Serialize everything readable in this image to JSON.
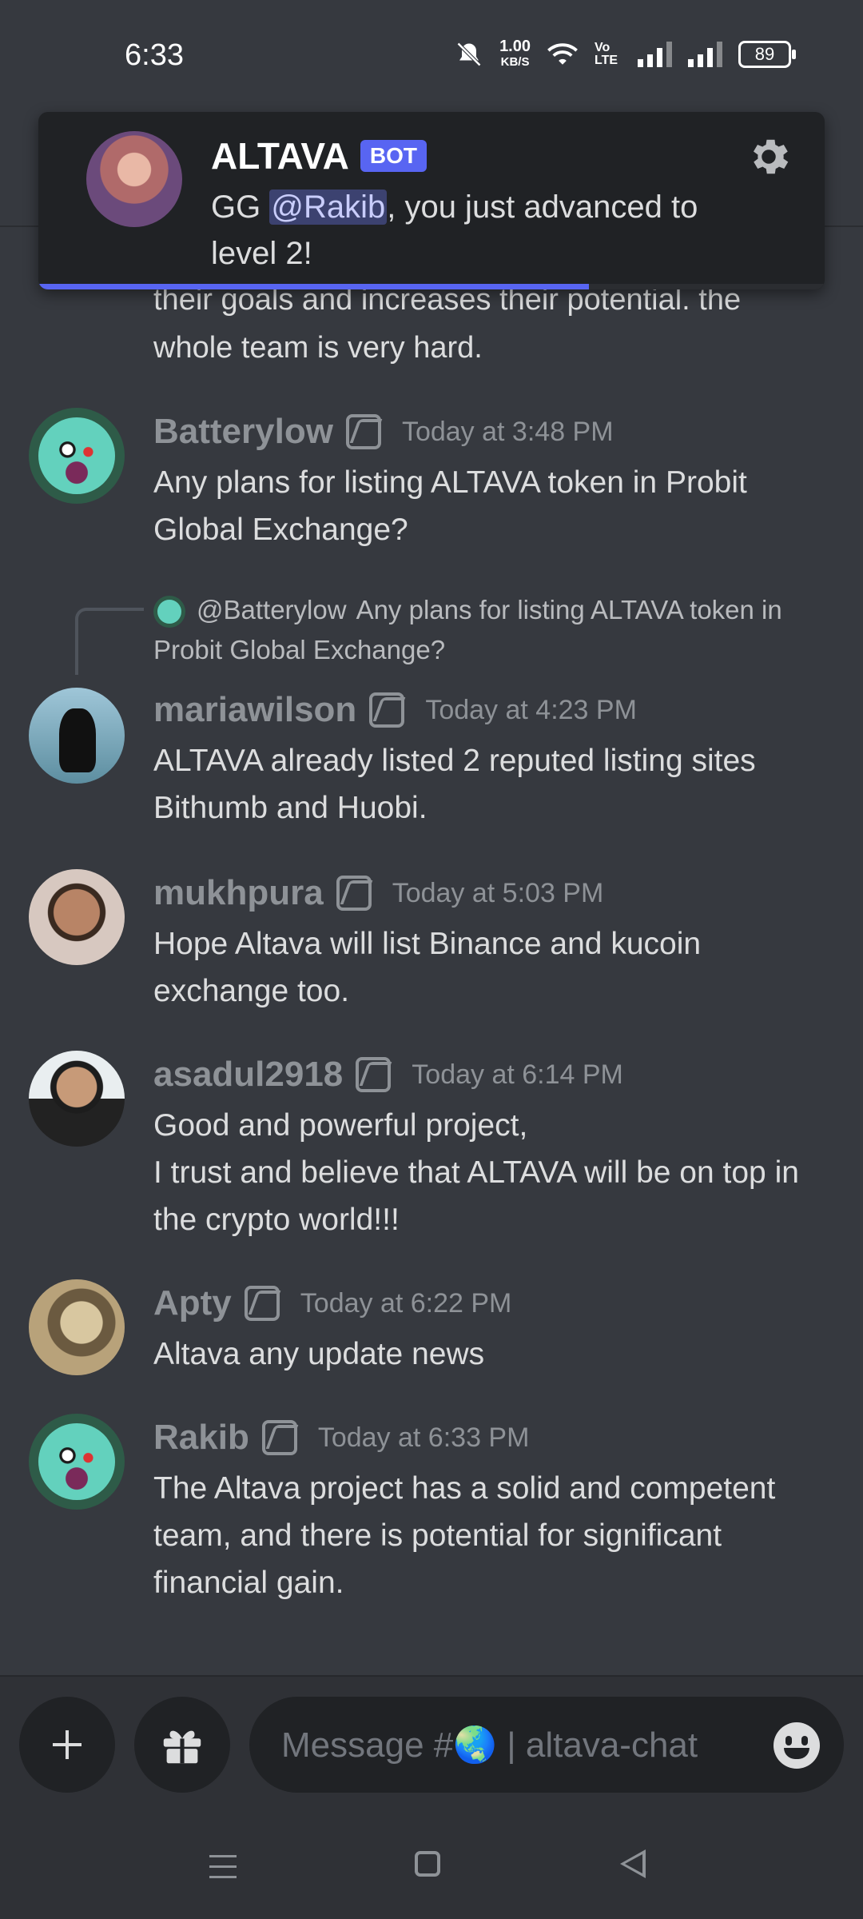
{
  "status_bar": {
    "time": "6:33",
    "net_speed_value": "1.00",
    "net_speed_unit": "KB/S",
    "volte": "Vo LTE",
    "battery": "89",
    "icons": [
      "silent-bell-icon",
      "wifi-icon",
      "volte-icon",
      "signal-icon",
      "signal-icon",
      "battery-icon"
    ]
  },
  "notification": {
    "sender": "ALTAVA",
    "badge": "BOT",
    "message_prefix": "GG ",
    "mention": "@Rakib",
    "message_suffix": ", you just advanced to level 2!",
    "progress": 0.7,
    "accent": "#5865f2"
  },
  "partial_message": {
    "text": "their goals and increases their potential. the whole team is very hard."
  },
  "messages": [
    {
      "author": "Batterylow",
      "timestamp": "Today at 3:48 PM",
      "text": "Any plans for listing ALTAVA token in Probit Global Exchange?"
    },
    {
      "author": "mariawilson",
      "timestamp": "Today at 4:23 PM",
      "text": "ALTAVA already listed 2 reputed listing sites Bithumb and Huobi.",
      "reply": {
        "author": "@Batterylow",
        "text": "Any plans for listing ALTAVA token in Probit Global Exchange?"
      }
    },
    {
      "author": "mukhpura",
      "timestamp": "Today at 5:03 PM",
      "text": "Hope Altava will list Binance and kucoin exchange too."
    },
    {
      "author": "asadul2918",
      "timestamp": "Today at 6:14 PM",
      "text": "Good and powerful project,\nI trust and believe that ALTAVA will be on top in the crypto world!!!"
    },
    {
      "author": "Apty",
      "timestamp": "Today at 6:22 PM",
      "text": "Altava any update news"
    },
    {
      "author": "Rakib",
      "timestamp": "Today at 6:33 PM",
      "text": "The Altava project has a solid and competent team, and there is potential for significant financial gain."
    }
  ],
  "composer": {
    "placeholder": "Message #🌏 | altava-chat"
  },
  "colors": {
    "background": "#36393f",
    "bar": "#2f3136",
    "text": "#dcddde",
    "muted": "#8e9297"
  }
}
